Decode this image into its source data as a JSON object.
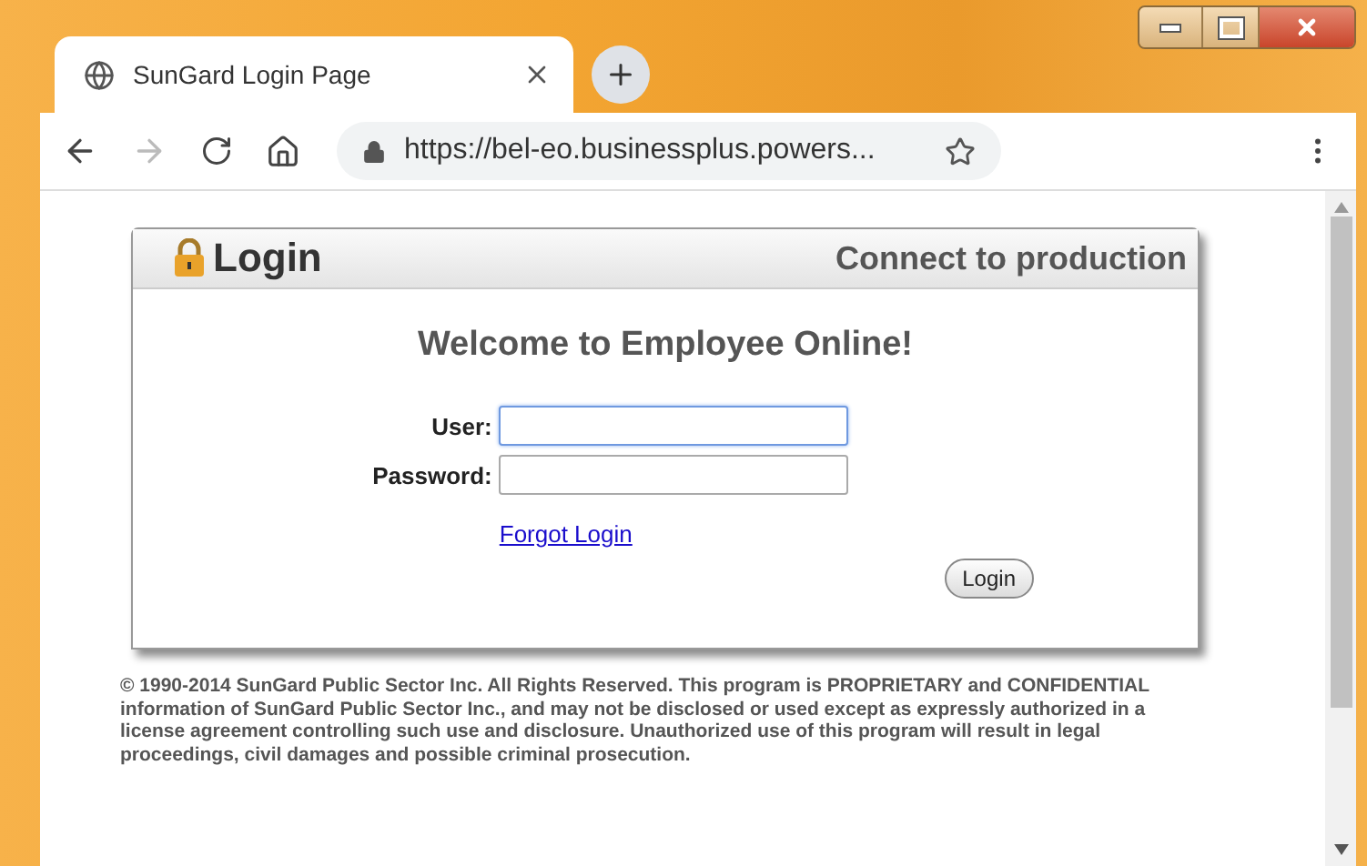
{
  "browser": {
    "tab": {
      "title": "SunGard Login Page",
      "selected": true
    },
    "address": "https://bel-eo.businessplus.powers..."
  },
  "login": {
    "title": "Login",
    "connection": "Connect to production",
    "welcome": "Welcome to Employee Online!",
    "fields": [
      {
        "label": "User:",
        "focused": true
      },
      {
        "label": "Password:",
        "focused": false
      }
    ],
    "forgot_link": "Forgot Login",
    "button": "Login"
  },
  "copyright": "© 1990-2014 SunGard Public Sector Inc. All Rights Reserved. This program is PROPRIETARY and CONFIDENTIAL information of SunGard Public Sector Inc., and may not be disclosed or used except as expressly authorized in a license agreement controlling such use and disclosure. Unauthorized use of this program will result in legal proceedings, civil damages and possible criminal prosecution."
}
